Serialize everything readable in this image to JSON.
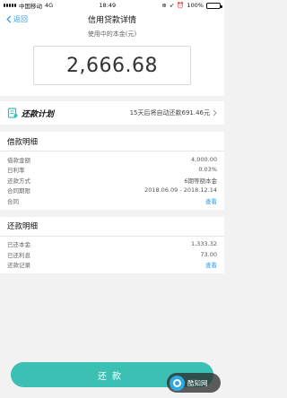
{
  "status_bar": {
    "carrier": "中国移动",
    "network": "4G",
    "time": "18:49",
    "battery": "100%"
  },
  "nav": {
    "back_label": "返回",
    "title": "信用贷款详情"
  },
  "hero": {
    "label": "使用中的本金(元)",
    "amount": "2,666.68"
  },
  "plan": {
    "title": "还款计划",
    "auto_text": "15天后将自动还款691.46元"
  },
  "loan_detail": {
    "title": "借款明细",
    "rows": [
      {
        "label": "借款金额",
        "value": "4,000.00"
      },
      {
        "label": "日利率",
        "value": "0.03%"
      },
      {
        "label": "还款方式",
        "value": "6期等额本金"
      },
      {
        "label": "合同期限",
        "value": "2018.06.09 - 2018.12.14"
      },
      {
        "label": "合同",
        "value": "查看"
      }
    ]
  },
  "repay_detail": {
    "title": "还款明细",
    "rows": [
      {
        "label": "已还本金",
        "value": "1,333.32"
      },
      {
        "label": "已还利息",
        "value": "73.00"
      },
      {
        "label": "还款记录",
        "value": "查看"
      }
    ]
  },
  "bottom": {
    "repay_label": "还款",
    "watermark_text": "酷知网"
  },
  "colors": {
    "accent": "#2e9bf0",
    "button": "#3cc0b4"
  }
}
